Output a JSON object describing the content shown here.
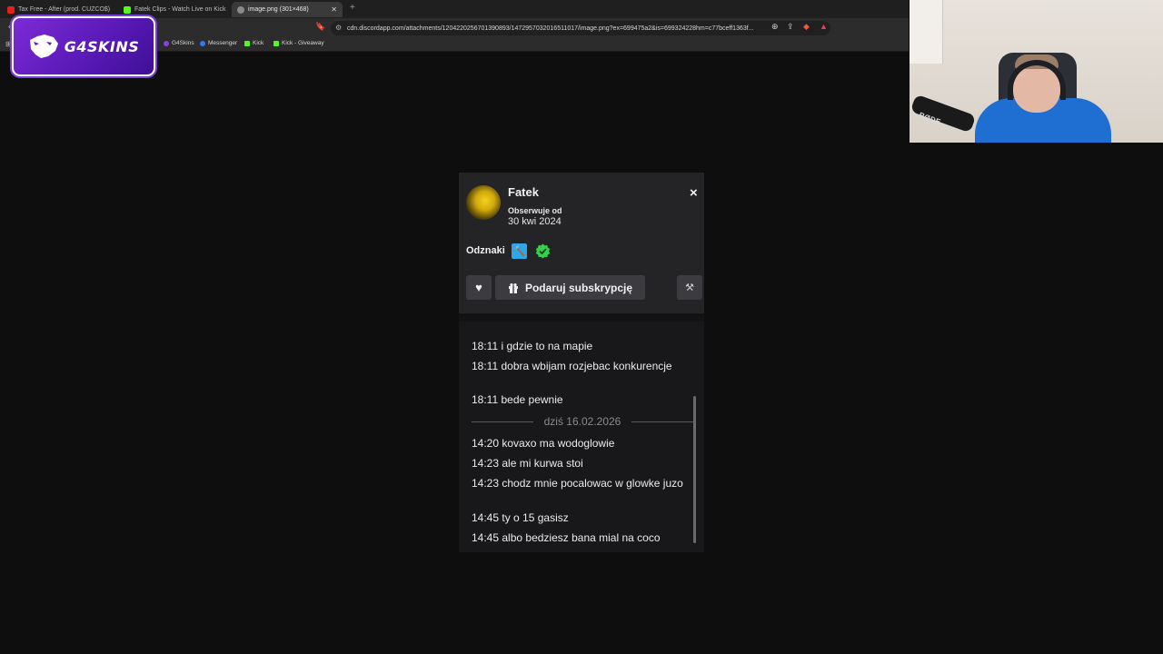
{
  "browser": {
    "tabs": [
      {
        "label": "Tax Free - After (prod. CUZCO$)",
        "icon_color": "#e62117",
        "active": false
      },
      {
        "label": "Fatek Clips - Watch Live on Kick",
        "icon_color": "#53fc18",
        "active": false
      },
      {
        "label": "image.png (301×468)",
        "icon_color": "#8a8a8a",
        "active": true
      }
    ],
    "new_tab": "+",
    "url": "cdn.discordapp.com/attachments/1204220256701390893/1472957032016511017/image.png?ex=699475a2&is=699324228hm=c77bceff1363f...",
    "bookmarks": [
      {
        "label": "G4Skins",
        "icon_color": "#8b3fe0"
      },
      {
        "label": "Messenger",
        "icon_color": "#2d7bf4"
      },
      {
        "label": "Kick",
        "icon_color": "#53fc18"
      },
      {
        "label": "Kick - Giveaway",
        "icon_color": "#53fc18"
      }
    ]
  },
  "overlay": {
    "logo_text": "G4SKINS",
    "logo_colors": {
      "bg": "#6a22c9",
      "border": "#ffffff"
    }
  },
  "webcam": {
    "mic_label": "RØDE"
  },
  "profile": {
    "username": "Fatek",
    "follow_label": "Obserwuje od",
    "follow_date": "30 kwi 2024",
    "badges_label": "Odznaki",
    "badges": [
      {
        "name": "moderator-badge",
        "color": "#2fa7e6"
      },
      {
        "name": "verified-badge",
        "color": "#36d14a"
      }
    ],
    "gift_label": "Podaruj subskrypcję",
    "close": "×"
  },
  "chat": {
    "messages_before": [
      {
        "time": "18:11",
        "text": "i gdzie to na mapie"
      },
      {
        "time": "18:11",
        "text": "dobra wbijam rozjebac konkurencje"
      },
      {
        "time": "18:11",
        "text": "bede pewnie"
      }
    ],
    "divider": "dziś 16.02.2026",
    "messages_after": [
      {
        "time": "14:20",
        "text": "kovaxo ma wodoglowie"
      },
      {
        "time": "14:23",
        "text": "ale mi kurwa stoi"
      },
      {
        "time": "14:23",
        "text": "chodz mnie pocalowac w glowke juzo"
      },
      {
        "time": "14:45",
        "text": "ty o 15 gasisz"
      },
      {
        "time": "14:45",
        "text": "albo bedziesz bana mial na coco"
      }
    ]
  }
}
